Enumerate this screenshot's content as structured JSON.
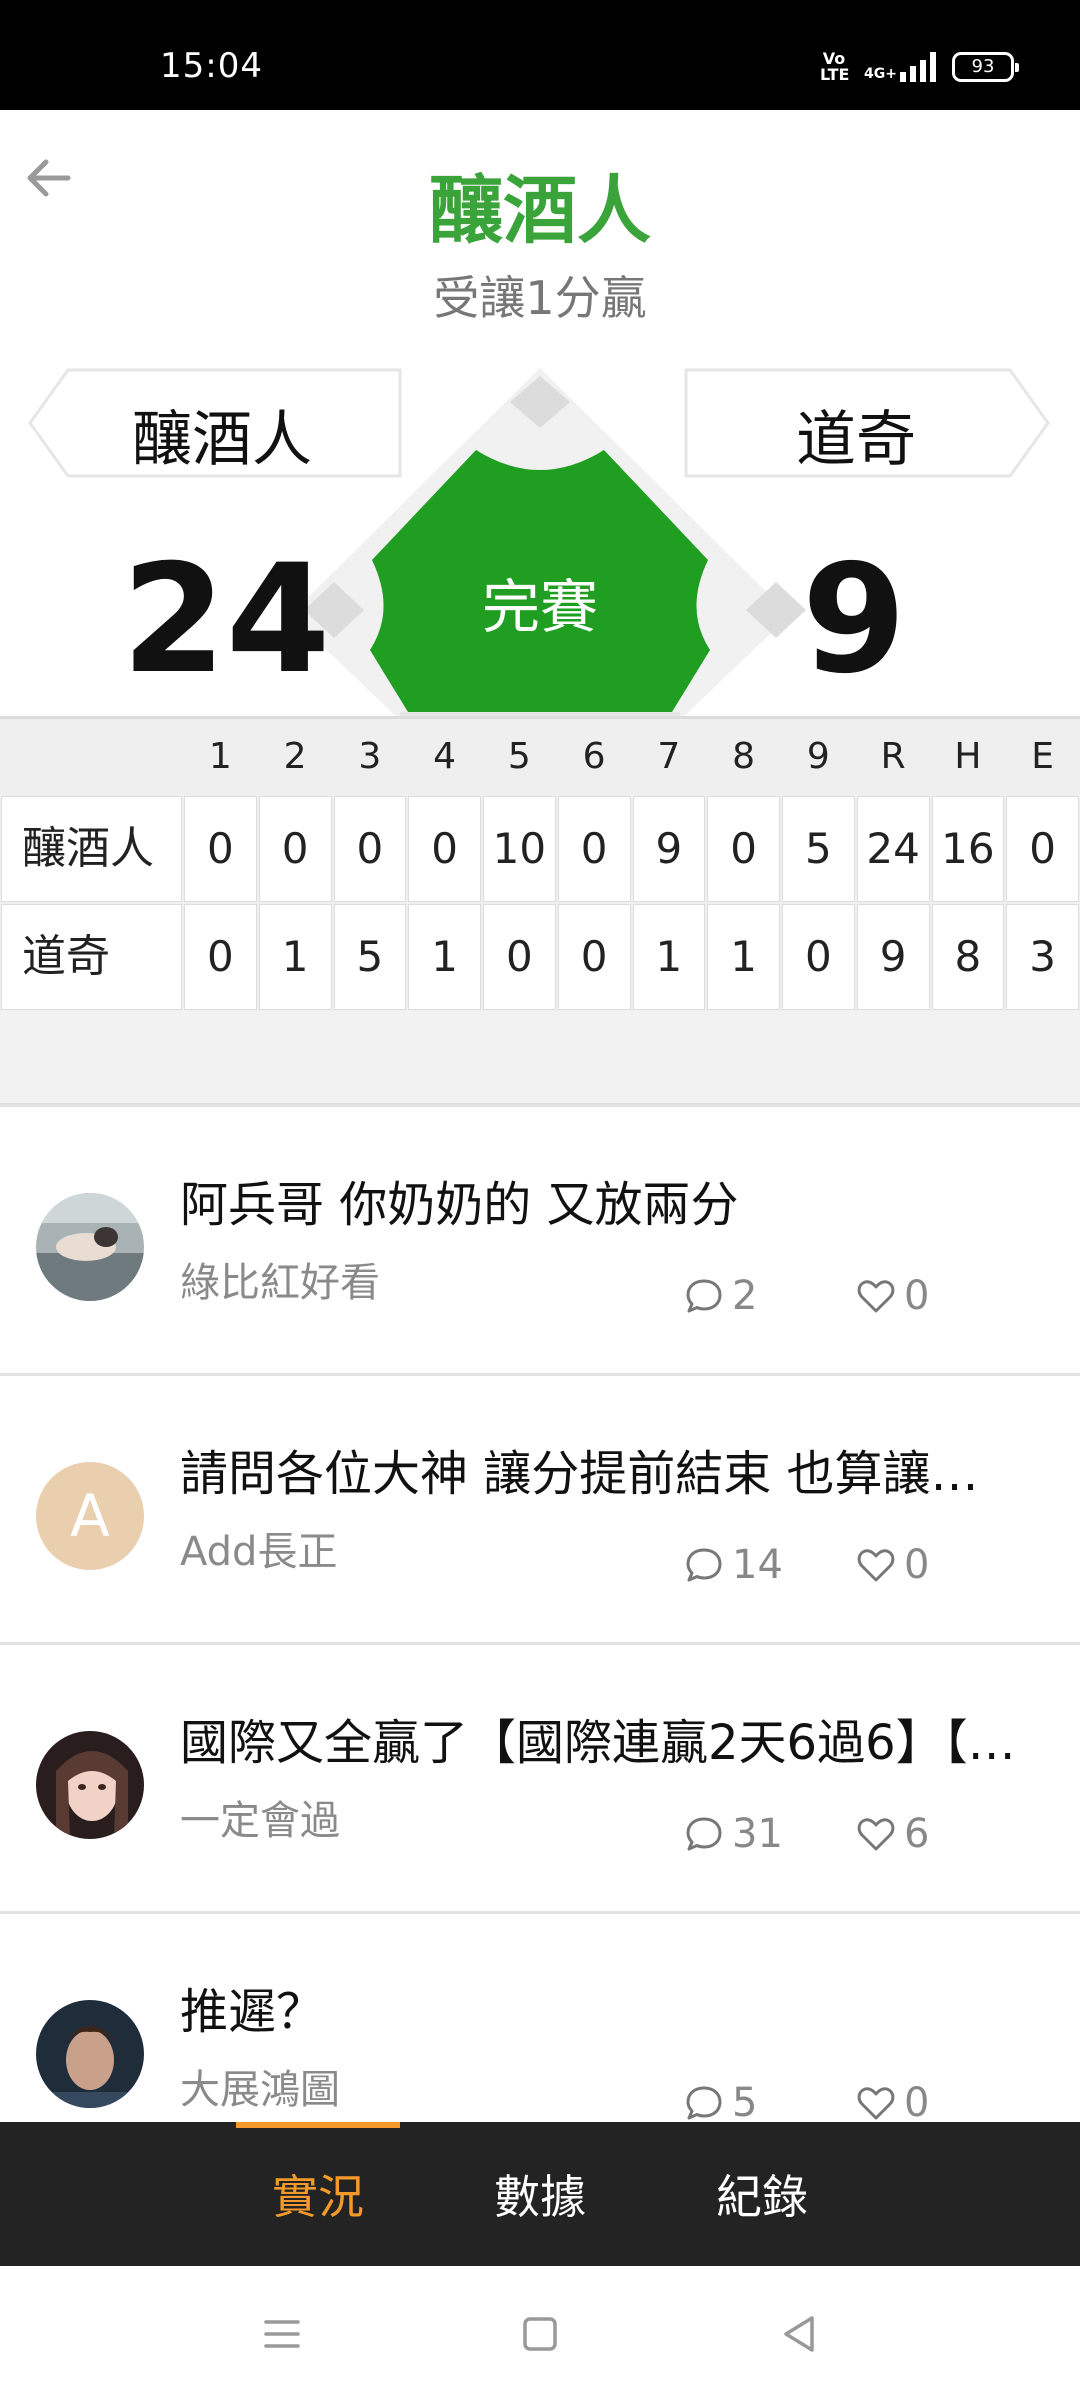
{
  "status_bar": {
    "time": "15:04",
    "volte": "Vo LTE",
    "network": "4G+",
    "battery": "93"
  },
  "header": {
    "back_icon": "arrow-left-icon",
    "title": "釀酒人",
    "subtitle": "受讓1分贏"
  },
  "game": {
    "home_team": "釀酒人",
    "away_team": "道奇",
    "home_score": "24",
    "away_score": "9",
    "status": "完賽"
  },
  "linescore": {
    "headers": [
      "1",
      "2",
      "3",
      "4",
      "5",
      "6",
      "7",
      "8",
      "9",
      "R",
      "H",
      "E"
    ],
    "rows": [
      {
        "team": "釀酒人",
        "values": [
          "0",
          "0",
          "0",
          "0",
          "10",
          "0",
          "9",
          "0",
          "5",
          "24",
          "16",
          "0"
        ]
      },
      {
        "team": "道奇",
        "values": [
          "0",
          "1",
          "5",
          "1",
          "0",
          "0",
          "1",
          "1",
          "0",
          "9",
          "8",
          "3"
        ]
      }
    ]
  },
  "posts": [
    {
      "title": "阿兵哥 你奶奶的 又放兩分",
      "author": "綠比紅好看",
      "comments": "2",
      "likes": "0",
      "avatar": "photo"
    },
    {
      "title": "請問各位大神 讓分提前結束 也算讓分…",
      "author": "Add長正",
      "comments": "14",
      "likes": "0",
      "avatar": "A"
    },
    {
      "title": "國際又全贏了【國際連贏2天6過6】【…",
      "author": "一定會過",
      "comments": "31",
      "likes": "6",
      "avatar": "photo"
    },
    {
      "title": "推遲？",
      "author": "大展鴻圖",
      "comments": "5",
      "likes": "0",
      "avatar": "photo"
    }
  ],
  "tabs": {
    "live": "實況",
    "data": "數據",
    "record": "紀錄"
  },
  "colors": {
    "accent_green": "#3aa33a",
    "diamond_green": "#1f9e22",
    "active_tab": "#f39a2a",
    "tabbar_bg": "#232323"
  },
  "icons": [
    "arrow-left-icon",
    "comment-icon",
    "heart-icon",
    "menu-icon",
    "home-square-icon",
    "back-triangle-icon"
  ]
}
